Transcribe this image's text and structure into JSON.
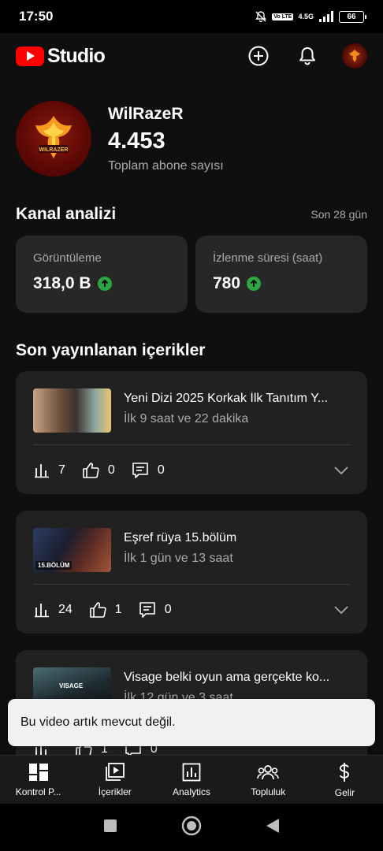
{
  "status_bar": {
    "time": "17:50",
    "network": "4.5G",
    "volte": "Vo LTE",
    "battery": "66"
  },
  "app_bar": {
    "title": "Studio"
  },
  "channel": {
    "name": "WilRazeR",
    "subscriber_count": "4.453",
    "subscriber_label": "Toplam abone sayısı",
    "logo_text": "WILRAZER"
  },
  "analytics": {
    "title": "Kanal analizi",
    "period": "Son 28 gün",
    "metrics": [
      {
        "label": "Görüntüleme",
        "value": "318,0 B",
        "trend": "up"
      },
      {
        "label": "İzlenme süresi (saat)",
        "value": "780",
        "trend": "up"
      }
    ]
  },
  "recent": {
    "title": "Son yayınlanan içerikler",
    "videos": [
      {
        "title": "Yeni Dizi 2025 Korkak İlk Tanıtım Y...",
        "subtitle": "İlk 9 saat ve 22 dakika",
        "views": "7",
        "likes": "0",
        "comments": "0",
        "thumb_tag": ""
      },
      {
        "title": "Eşref rüya 15.bölüm",
        "subtitle": "İlk 1 gün ve 13 saat",
        "views": "24",
        "likes": "1",
        "comments": "0",
        "thumb_tag": "15.BÖLÜM"
      },
      {
        "title": "Visage belki oyun ama gerçekte ko...",
        "subtitle": "İlk 12 gün ve 3 saat",
        "views": "",
        "likes": "1",
        "comments": "0",
        "thumb_tag": "VISAGE"
      }
    ]
  },
  "snackbar": {
    "message": "Bu video artık mevcut değil."
  },
  "bottom_nav": [
    {
      "label": "Kontrol P...",
      "icon": "dashboard-icon"
    },
    {
      "label": "İçerikler",
      "icon": "content-icon"
    },
    {
      "label": "Analytics",
      "icon": "analytics-icon"
    },
    {
      "label": "Topluluk",
      "icon": "community-icon"
    },
    {
      "label": "Gelir",
      "icon": "earn-icon"
    }
  ],
  "colors": {
    "background": "#0f0f0f",
    "card": "#272727",
    "accent_red": "#ff0000",
    "trend_green": "#2ba640"
  }
}
